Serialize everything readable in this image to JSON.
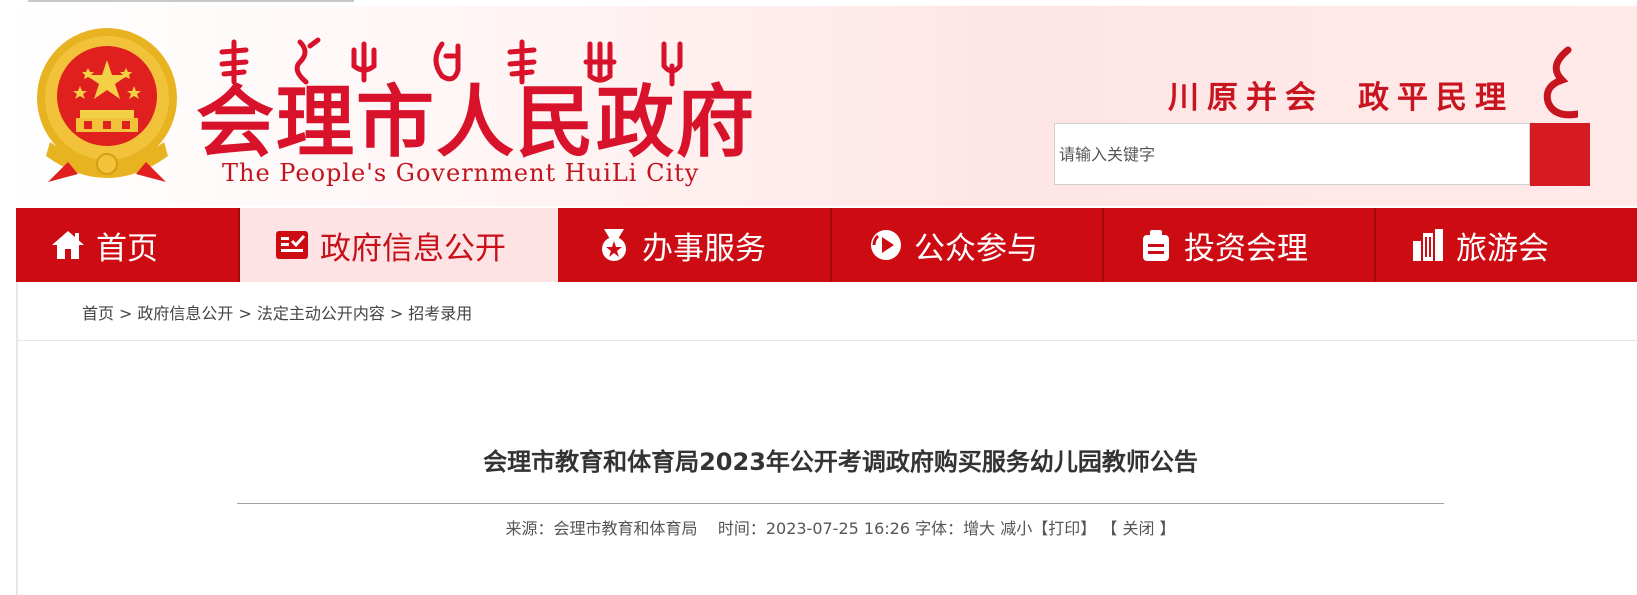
{
  "header": {
    "site_title": "会理市人民政府",
    "site_subtitle": "The People's Government HuiLi City",
    "slogan_part1": "川原并会",
    "slogan_part2": "政平民理",
    "search": {
      "placeholder": "请输入关键字"
    }
  },
  "nav": {
    "items": [
      {
        "label": "首页",
        "icon": "home-icon"
      },
      {
        "label": "政府信息公开",
        "icon": "info-disclosure-icon",
        "active": true
      },
      {
        "label": "办事服务",
        "icon": "medal-icon"
      },
      {
        "label": "公众参与",
        "icon": "participation-icon"
      },
      {
        "label": "投资会理",
        "icon": "briefcase-icon"
      },
      {
        "label": "旅游会",
        "icon": "buildings-icon"
      }
    ]
  },
  "breadcrumb": {
    "items": [
      "首页",
      "政府信息公开",
      "法定主动公开内容",
      "招考录用"
    ],
    "separator": ">"
  },
  "article": {
    "title": "会理市教育和体育局2023年公开考调政府购买服务幼儿园教师公告",
    "source_label": "来源：",
    "source": "会理市教育和体育局",
    "time_label": "时间：",
    "time": "2023-07-25 16:26",
    "font_label": "字体：",
    "font_larger": "增大",
    "font_smaller": "减小",
    "print": "【打印】",
    "close": "【 关闭 】"
  },
  "colors": {
    "brand_red": "#cd0b12",
    "active_tab_bg": "#fde3e3",
    "title_red": "#d7122a"
  }
}
